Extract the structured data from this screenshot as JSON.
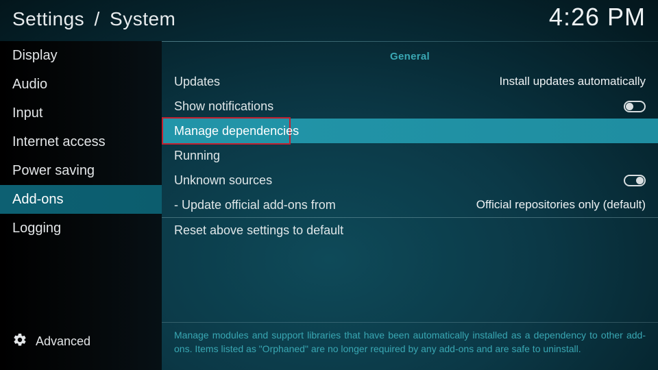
{
  "header": {
    "breadcrumb_root": "Settings",
    "breadcrumb_section": "System"
  },
  "clock": "4:26 PM",
  "sidebar": {
    "items": [
      {
        "label": "Display"
      },
      {
        "label": "Audio"
      },
      {
        "label": "Input"
      },
      {
        "label": "Internet access"
      },
      {
        "label": "Power saving"
      },
      {
        "label": "Add-ons"
      },
      {
        "label": "Logging"
      }
    ],
    "selected_index": 5,
    "level_label": "Advanced"
  },
  "section_heading": "General",
  "rows": {
    "updates": {
      "label": "Updates",
      "value": "Install updates automatically"
    },
    "show_notifs": {
      "label": "Show notifications",
      "toggle": "off"
    },
    "manage_deps": {
      "label": "Manage dependencies"
    },
    "running": {
      "label": "Running"
    },
    "unknown": {
      "label": "Unknown sources",
      "toggle": "on"
    },
    "update_from": {
      "label": "Update official add-ons from",
      "value": "Official repositories only (default)"
    },
    "reset": {
      "label": "Reset above settings to default"
    }
  },
  "highlighted_row": "manage_deps",
  "description": "Manage modules and support libraries that have been automatically installed as a dependency to other add-ons. Items listed as \"Orphaned\" are no longer required by any add-ons and are safe to uninstall."
}
